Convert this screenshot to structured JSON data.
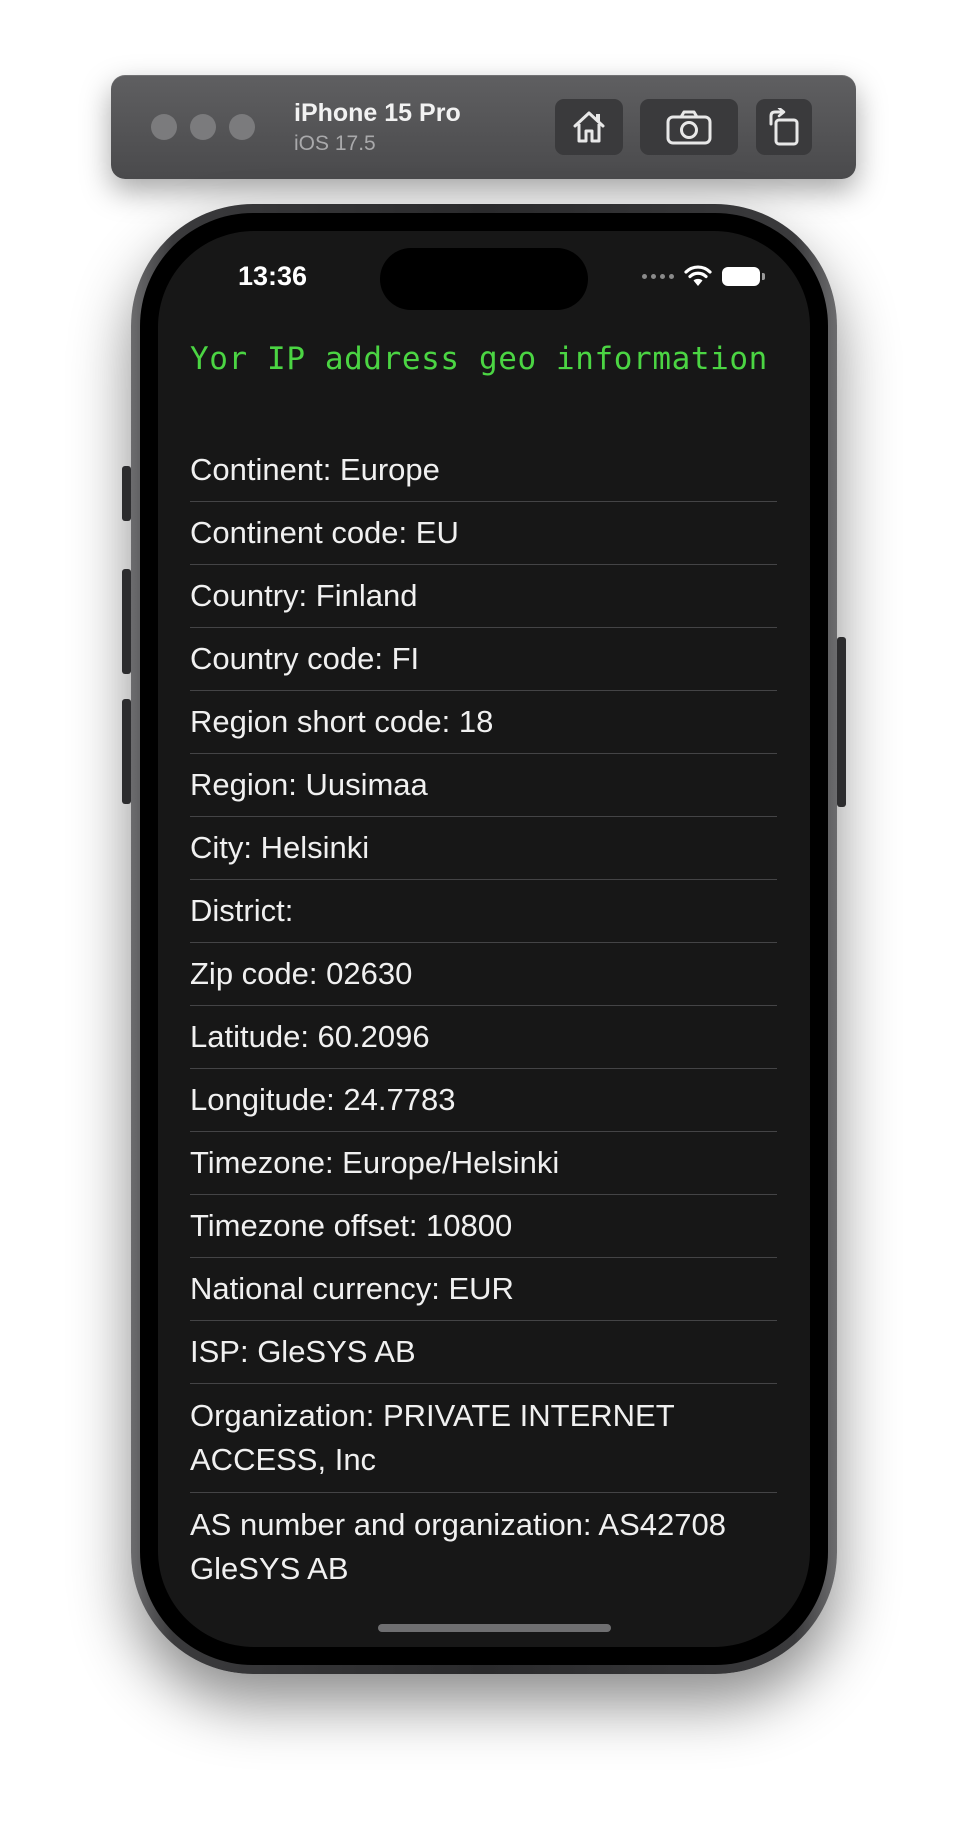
{
  "simulator": {
    "device_name": "iPhone 15 Pro",
    "os_version": "iOS 17.5",
    "buttons": [
      "home-icon",
      "screenshot-icon",
      "rotate-icon"
    ]
  },
  "status_bar": {
    "time": "13:36",
    "icons": [
      "signal-dots-icon",
      "wifi-icon",
      "battery-icon"
    ]
  },
  "app": {
    "title": "Yor IP address geo information",
    "colors": {
      "title": "#4bd543",
      "background": "#171717",
      "text": "#f0f0f0",
      "divider": "#444446"
    },
    "rows": [
      "Continent: Europe",
      "Continent code: EU",
      "Country: Finland",
      "Country code: FI",
      "Region short code: 18",
      "Region: Uusimaa",
      "City: Helsinki",
      "District:",
      "Zip code: 02630",
      "Latitude: 60.2096",
      "Longitude: 24.7783",
      "Timezone: Europe/Helsinki",
      "Timezone offset: 10800",
      "National currency: EUR",
      "ISP: GleSYS AB",
      "Organization: PRIVATE INTERNET ACCESS, Inc",
      "AS number and organization: AS42708 GleSYS AB"
    ]
  }
}
